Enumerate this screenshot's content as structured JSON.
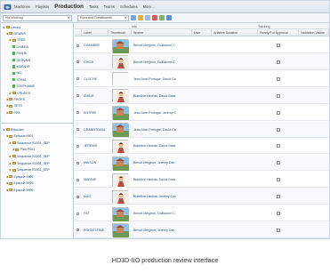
{
  "menubar": {
    "items": [
      {
        "label": "Machines",
        "active": false
      },
      {
        "label": "Playlists",
        "active": false
      },
      {
        "label": "Production",
        "active": true
      },
      {
        "label": "Tasks",
        "active": false
      },
      {
        "label": "Teams",
        "active": false
      },
      {
        "label": "Schedules",
        "active": false
      },
      {
        "label": "More...",
        "active": false
      }
    ]
  },
  "toolbar": {
    "filter_select": "Not Working",
    "view_select": "Eyes and Constituents",
    "colors": [
      "#7aa7d9",
      "#e4b04a",
      "#9ab8dd",
      "#d85a5a",
      "#7fb26b",
      "#5b8fd0"
    ]
  },
  "tree_top": [
    {
      "label": "Library",
      "icon": "folder"
    },
    {
      "label": "DRAWS",
      "icon": "folder"
    },
    {
      "label": "TREE",
      "icon": "folder"
    },
    {
      "label": "CHIKEN",
      "icon": "leaf"
    },
    {
      "label": "EMILIE",
      "icon": "leaf"
    },
    {
      "label": "GERVAIS",
      "icon": "leaf"
    },
    {
      "label": "MARNYE",
      "icon": "leaf"
    },
    {
      "label": "NIC",
      "icon": "leaf"
    },
    {
      "label": "STING",
      "icon": "leaf"
    },
    {
      "label": "STEPHANIE",
      "icon": "leaf"
    },
    {
      "label": "CRUDES",
      "icon": "folder"
    },
    {
      "label": "PROPS",
      "icon": "folder"
    },
    {
      "label": "SETS",
      "icon": "folder"
    },
    {
      "label": "FPX",
      "icon": "folder"
    }
  ],
  "tree_bottom": [
    {
      "label": "Episodes",
      "icon": "folder"
    },
    {
      "label": "Episode 0001",
      "icon": "folder"
    },
    {
      "label": "Sequence S0001_SEP",
      "icon": "folder"
    },
    {
      "label": "Plan P001",
      "icon": "folder"
    },
    {
      "label": "Sequence S0001_SEP",
      "icon": "folder"
    },
    {
      "label": "Sequence S0001_SEP",
      "icon": "folder"
    },
    {
      "label": "Sequence S0001_SEP",
      "icon": "folder"
    },
    {
      "label": "Episode 0002",
      "icon": "folder"
    },
    {
      "label": "Episode 0003",
      "icon": "folder"
    },
    {
      "label": "Episode 0004",
      "icon": "folder"
    }
  ],
  "grid": {
    "group_headers": {
      "info": "Info",
      "tracking": "Tracking"
    },
    "columns": [
      "Label",
      "Thumbnail",
      "Worker",
      "User",
      "Artistics Duration",
      "Ready For Approval",
      "Validation Visible"
    ],
    "rows": [
      {
        "label": "CHAMBRE",
        "worker": "Benoît Meyjeon, Guillaume C",
        "thumb": "thumb-landscape"
      },
      {
        "label": "CHICH",
        "worker": "Benoît Meyjeon, Guillaume C",
        "thumb": "thumb-character"
      },
      {
        "label": "CLOCHE",
        "worker": "Jean-Noel Portugal, David Ga",
        "thumb": "thumb-blank"
      },
      {
        "label": "EMILIE",
        "worker": "Blandine Heizias, David Gass",
        "thumb": "thumb-character"
      },
      {
        "label": "ENTREE",
        "worker": "Jean-Noel Portugal, Jeremy C",
        "thumb": "thumb-landscape"
      },
      {
        "label": "GRANDTRAIN",
        "worker": "Jean-Noel Portugal, David Ga",
        "thumb": "thumb-landscape"
      },
      {
        "label": "JEREMIE",
        "worker": "Blandine Heizias, David Gass",
        "thumb": "thumb-character"
      },
      {
        "label": "MAISON",
        "worker": "Benoît Meyjeon, Jeremy Cah",
        "thumb": "thumb-landscape"
      },
      {
        "label": "MARINE",
        "worker": "Blandine Heizias, David Gass",
        "thumb": "thumb-character"
      },
      {
        "label": "NUG",
        "worker": "Blandine Heizias, Jeremy Cah",
        "thumb": "thumb-character"
      },
      {
        "label": "PAT",
        "worker": "Benoît Meyjeon, Guillaume C",
        "thumb": "thumb-landscape"
      },
      {
        "label": "PORTESTIME",
        "worker": "Benoît Meyjeon, Jeremy Cah",
        "thumb": "thumb-landscape"
      }
    ]
  },
  "caption": "HD3D-IIO production review interface"
}
